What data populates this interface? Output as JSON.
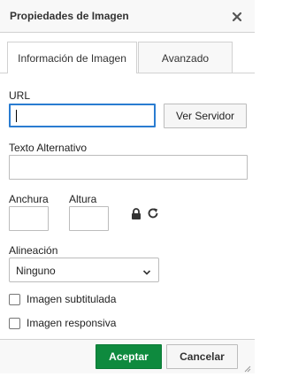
{
  "dialog": {
    "title": "Propiedades de Imagen",
    "close_icon": "close-icon"
  },
  "tabs": [
    {
      "label": "Información de Imagen",
      "active": true
    },
    {
      "label": "Avanzado",
      "active": false
    }
  ],
  "url": {
    "label": "URL",
    "value": "",
    "browse_button": "Ver Servidor"
  },
  "alt_text": {
    "label": "Texto Alternativo",
    "value": ""
  },
  "dimensions": {
    "width_label": "Anchura",
    "height_label": "Altura",
    "width_value": "",
    "height_value": "",
    "lock_icon": "lock-icon",
    "reset_icon": "reset-size-icon"
  },
  "alignment": {
    "label": "Alineación",
    "selected": "Ninguno"
  },
  "checkboxes": [
    {
      "label": "Imagen subtitulada",
      "checked": false
    },
    {
      "label": "Imagen responsiva",
      "checked": false
    }
  ],
  "footer": {
    "ok_label": "Aceptar",
    "cancel_label": "Cancelar"
  },
  "colors": {
    "accent_focus": "#2a7cd1",
    "ok_button": "#0e8a3e"
  }
}
